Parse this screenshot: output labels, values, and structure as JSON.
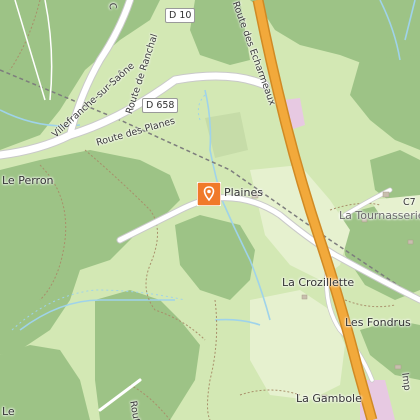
{
  "map": {
    "colors": {
      "forest": "#9dc386",
      "meadow": "#d3e8b4",
      "light_meadow": "#e6f1cf",
      "main_road": "#f2a93b",
      "road": "#ffffff",
      "water": "#9fd3ea",
      "railway": "#7d7d7d",
      "marker": "#f07a2a"
    },
    "shields": {
      "d10": "D 10",
      "d658": "D 658"
    },
    "labels": {
      "route_de_ranchal": "Route de Ranchal",
      "route_des_echarmeaux": "Route des Echarmeaux",
      "villefranche": "Villefranche-sur-Saône",
      "route_des_planes": "Route des Planes",
      "le_perron": "Le Perron",
      "plaines": "Plaines",
      "la_tournasserie": "La Tournasserie",
      "c7": "C7",
      "la_crozillette": "La Crozillette",
      "les_fondrus": "Les Fondrus",
      "la_gambole": "La Gambole",
      "route_bottom": "Route",
      "imp": "Imp",
      "le": "Le",
      "c_top": "C"
    },
    "marker_icon": "map-pin-icon"
  }
}
